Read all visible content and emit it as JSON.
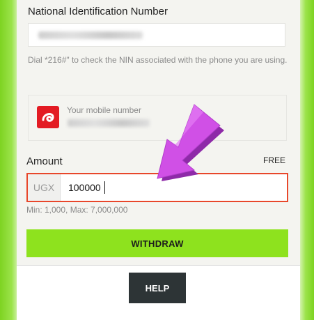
{
  "nin": {
    "label": "National Identification Number",
    "value": "",
    "hint": "Dial *216#\" to check the NIN associated with the phone you are using."
  },
  "mobile": {
    "label": "Your mobile number",
    "value": "",
    "logo": "airtel-logo"
  },
  "amount": {
    "label": "Amount",
    "fee_label": "FREE",
    "currency": "UGX",
    "value": "100000",
    "limits": "Min: 1,000, Max: 7,000,000"
  },
  "buttons": {
    "withdraw": "WITHDRAW",
    "help": "HELP"
  },
  "colors": {
    "accent_green": "#8ee21e",
    "error_border": "#e8472b",
    "arrow_purple": "#c84bde",
    "airtel_red": "#e31b23"
  },
  "icons": {
    "pointer_arrow": "pointer-arrow-icon"
  }
}
